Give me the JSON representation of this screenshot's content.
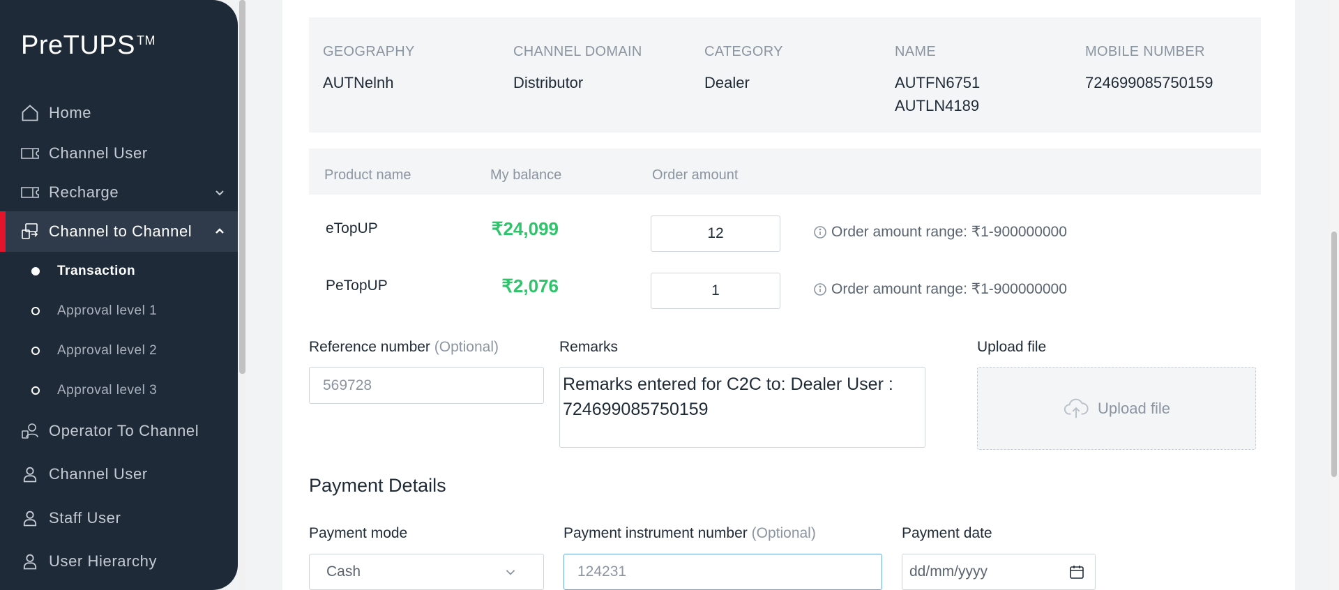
{
  "sidebar": {
    "logo": "PreTUPS",
    "logo_tm": "TM",
    "items": [
      {
        "label": "Home",
        "icon": "home-icon"
      },
      {
        "label": "Channel User",
        "icon": "ticket-icon"
      },
      {
        "label": "Recharge",
        "icon": "ticket-icon",
        "expand": "chevron-down-icon"
      },
      {
        "label": "Channel to Channel",
        "icon": "transfer-icon",
        "expand": "chevron-up-icon"
      },
      {
        "label": "Operator To Channel",
        "icon": "operator-icon"
      },
      {
        "label": "Channel User",
        "icon": "user-icon"
      },
      {
        "label": "Staff User",
        "icon": "user-icon"
      },
      {
        "label": "User Hierarchy",
        "icon": "user-icon"
      }
    ],
    "sub_items": [
      {
        "label": "Transaction",
        "selected": true
      },
      {
        "label": "Approval level 1"
      },
      {
        "label": "Approval level 2"
      },
      {
        "label": "Approval level 3"
      }
    ]
  },
  "user_info": {
    "geography": {
      "label": "GEOGRAPHY",
      "value": "AUTNelnh"
    },
    "domain": {
      "label": "CHANNEL DOMAIN",
      "value": "Distributor"
    },
    "category": {
      "label": "CATEGORY",
      "value": "Dealer"
    },
    "name": {
      "label": "NAME",
      "value": "AUTFN6751\nAUTLN4189"
    },
    "mobile": {
      "label": "MOBILE NUMBER",
      "value": "724699085750159"
    }
  },
  "products": {
    "headers": {
      "name": "Product name",
      "balance": "My balance",
      "amount": "Order amount"
    },
    "rows": [
      {
        "name": "eTopUP",
        "balance": "₹24,099",
        "amount": "12",
        "range": "Order amount range: ₹1-900000000"
      },
      {
        "name": "PeTopUP",
        "balance": "₹2,076",
        "amount": "1",
        "range": "Order amount range: ₹1-900000000"
      }
    ]
  },
  "form": {
    "reference_label": "Reference number",
    "optional": "(Optional)",
    "reference_placeholder": "569728",
    "remarks_label": "Remarks",
    "remarks_value": "Remarks entered for C2C to: Dealer User : 724699085750159",
    "upload_label": "Upload file",
    "upload_button": "Upload file"
  },
  "payment": {
    "title": "Payment Details",
    "mode_label": "Payment mode",
    "mode_value": "Cash",
    "instrument_label": "Payment instrument number",
    "instrument_value": "124231",
    "date_label": "Payment date",
    "date_placeholder": "dd/mm/yyyy"
  },
  "colors": {
    "sidebar_bg": "#1f2a38",
    "accent": "#e4152b",
    "balance": "#2fc46b"
  }
}
